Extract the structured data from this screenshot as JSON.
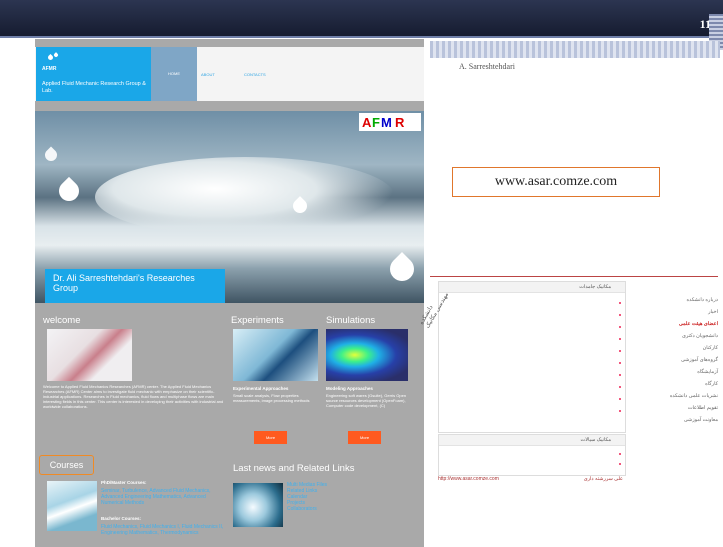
{
  "slide": {
    "number": "11",
    "author": "A. Sarreshtehdari",
    "url": "www.asar.comze.com"
  },
  "site": {
    "logo_title": "AFMR",
    "logo_subtitle": "Applied Fluid Mechanic Research Group & Lab.",
    "nav": [
      "HOME",
      "ABOUT",
      "CONTACTS"
    ],
    "hero_title": "Dr. Ali Sarreshtehdari's Researches Group",
    "afmr_badge": "AFMR",
    "welcome": {
      "title": "welcome",
      "text": "Welcome to Applied Fluid Mechanics Researches (AFMR) center. The Applied Fluid Mechanics Researches (AFMR) Center aims to investigate fluid mechanic with emphasize on their scientific-industrial applications. Researches in Fluid mechanics, fluid flows and multiphase flows are main interesting fields in this center. This center is interested in developing their activities with industrial and worldwide collaborations."
    },
    "experiments": {
      "title": "Experiments",
      "subtitle": "Experimental Approaches",
      "text": "Small scale analysis, Flow properties measurements, image processing methods",
      "more": "More"
    },
    "simulations": {
      "title": "Simulations",
      "subtitle": "Modeling Approaches",
      "text": "Engineering soft wares (Gsuite), Gerris Open source resources development (OpenFoam), Computer code development, (C)",
      "more": "More"
    },
    "courses": {
      "title": "Courses",
      "phd_heading": "PhD/Master Courses:",
      "phd_text": "Seminar, Turbulence, Advanced Fluid Mechanics, Advanced Engineering Mathematics, Advanced Numerical Methods",
      "bachelor_heading": "Bachelor Courses:",
      "bachelor_text": "Fluid Mechanics, Fluid Mechanics I, Fluid Mechanics II, Engineering Mathematics, Thermodynamics"
    },
    "news": {
      "title": "Last news and Related Links",
      "links": [
        "Multi Medias Files",
        "Related Links",
        "Calendar",
        "Projects",
        "Collaborators"
      ]
    }
  },
  "lms": {
    "panel1_title": "مکانیک جامدات",
    "panel2_title": "مکانیک سیالات",
    "sidebar": [
      "درباره دانشکده",
      "اخبار",
      "اعضای هیئت علمی",
      "دانشجویان دکتری",
      "کارکنان",
      "گروه‌های آموزشی",
      "آزمایشگاه",
      "کارگاه",
      "نشریات علمی دانشکده",
      "تقویم اطلاعات",
      "معاونت آموزشی"
    ],
    "footer_url": "http://www.asar.comze.com",
    "footer_label": "علی سررشته داری",
    "signature": "دانشکده مهندسی مکانیک"
  },
  "colors": {
    "accent": "#1aa7e8",
    "orange": "#ff5a1f",
    "topbar": "#1f2740"
  }
}
